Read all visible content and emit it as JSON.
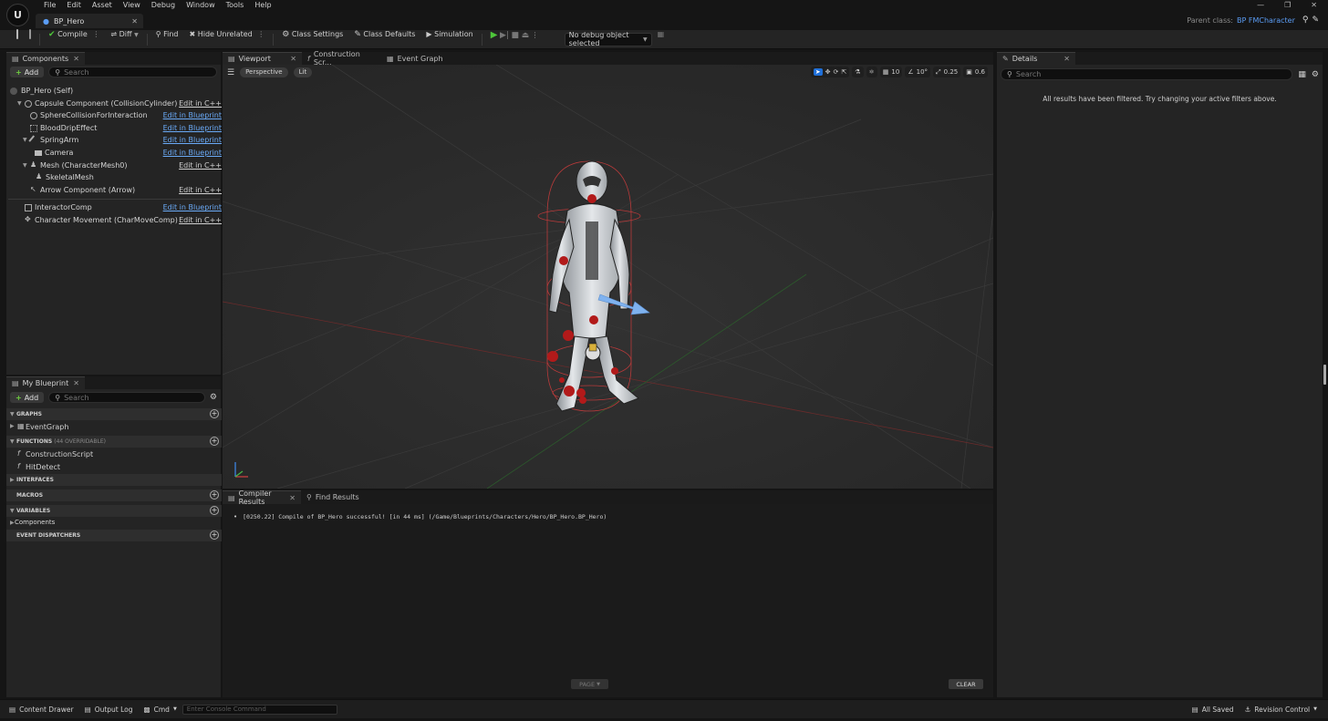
{
  "app": {
    "logo_text": "U",
    "document_tab": "BP_Hero",
    "parent_class_label": "Parent class:",
    "parent_class_value": "BP FMCharacter"
  },
  "menu": [
    "File",
    "Edit",
    "Asset",
    "View",
    "Debug",
    "Window",
    "Tools",
    "Help"
  ],
  "toolbar": {
    "compile": "Compile",
    "diff": "Diff",
    "find": "Find",
    "hide_unrelated": "Hide Unrelated",
    "class_settings": "Class Settings",
    "class_defaults": "Class Defaults",
    "simulation": "Simulation",
    "debug_object": "No debug object selected"
  },
  "components_panel": {
    "tab": "Components",
    "add": "Add",
    "search_placeholder": "Search",
    "items": [
      {
        "label": "BP_Hero (Self)",
        "edit": ""
      },
      {
        "label": "Capsule Component (CollisionCylinder)",
        "edit": "Edit in C++"
      },
      {
        "label": "SphereCollisionForInteraction",
        "edit": "Edit in Blueprint"
      },
      {
        "label": "BloodDripEffect",
        "edit": "Edit in Blueprint"
      },
      {
        "label": "SpringArm",
        "edit": "Edit in Blueprint"
      },
      {
        "label": "Camera",
        "edit": "Edit in Blueprint"
      },
      {
        "label": "Mesh (CharacterMesh0)",
        "edit": "Edit in C++"
      },
      {
        "label": "SkeletalMesh",
        "edit": ""
      },
      {
        "label": "Arrow Component (Arrow)",
        "edit": "Edit in C++"
      },
      {
        "label": "InteractorComp",
        "edit": "Edit in Blueprint"
      },
      {
        "label": "Character Movement (CharMoveComp)",
        "edit": "Edit in C++"
      }
    ]
  },
  "my_blueprint": {
    "tab": "My Blueprint",
    "add": "Add",
    "search_placeholder": "Search",
    "graphs": "GRAPHS",
    "event_graph": "EventGraph",
    "functions": "FUNCTIONS",
    "functions_sub": "(44 OVERRIDABLE)",
    "construction_script": "ConstructionScript",
    "hit_detect": "HitDetect",
    "interfaces": "INTERFACES",
    "macros": "MACROS",
    "variables": "VARIABLES",
    "components": "Components",
    "event_dispatchers": "EVENT DISPATCHERS"
  },
  "editor_tabs": {
    "viewport": "Viewport",
    "construction": "Construction Scr...",
    "event_graph": "Event Graph"
  },
  "viewport": {
    "perspective": "Perspective",
    "lit": "Lit",
    "grid_snap": "10",
    "rot_snap": "10°",
    "scale_snap": "0.25",
    "camera_speed": "0.6"
  },
  "details": {
    "tab": "Details",
    "search_placeholder": "Search",
    "message": "All results have been filtered. Try changing your active filters above."
  },
  "bottom": {
    "compiler_tab": "Compiler Results",
    "find_tab": "Find Results",
    "log": "[0250.22] Compile of BP_Hero successful! [in 44 ms] (/Game/Blueprints/Characters/Hero/BP_Hero.BP_Hero)",
    "page": "PAGE",
    "clear": "CLEAR"
  },
  "statusbar": {
    "content_drawer": "Content Drawer",
    "output_log": "Output Log",
    "cmd": "Cmd",
    "console_placeholder": "Enter Console Command",
    "all_saved": "All Saved",
    "revision_control": "Revision Control"
  },
  "colors": {
    "accent_blue": "#5b9df5",
    "add_green": "#6fcf3f",
    "play_green": "#4ec63a",
    "panel_bg": "#242424",
    "viewport_bg": "#2b2b2b"
  }
}
